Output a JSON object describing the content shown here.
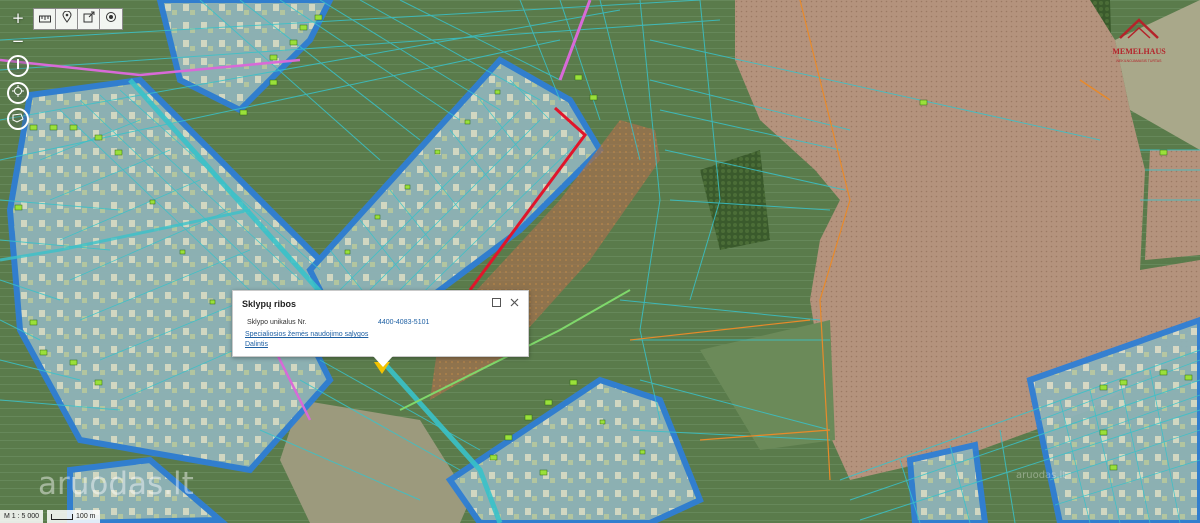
{
  "toolbar": {
    "zoom_in": "+",
    "zoom_out": "−",
    "tools": [
      "ruler-icon",
      "pin-icon",
      "export-icon",
      "target-icon"
    ],
    "side_buttons": [
      "compass-icon",
      "locate-icon",
      "area-select-icon"
    ]
  },
  "popup": {
    "title": "Sklypų ribos",
    "label": "Sklypo unikalus Nr.",
    "value": "4400-4083-5101",
    "link1": "Specialiosios žemės naudojimo sąlygos",
    "link2": "Dalintis"
  },
  "logo": {
    "brand": "MEMELHAUS",
    "tagline": "NEKILNOJAMASIS TURTAS",
    "color": "#b4232a"
  },
  "scale": {
    "ratio": "M 1 : 5 000",
    "distance": "100 m"
  },
  "watermark": "aruodas.lt",
  "watermark_small": "aruodas.lt",
  "colors": {
    "parcel_line": "#39c2c9",
    "protected_zone": "#2f7fd6",
    "plowed_field": "#b58a73",
    "grass": "#5f7a52",
    "selected_parcel": "#e0162b",
    "utility_line": "#d86ad8"
  }
}
